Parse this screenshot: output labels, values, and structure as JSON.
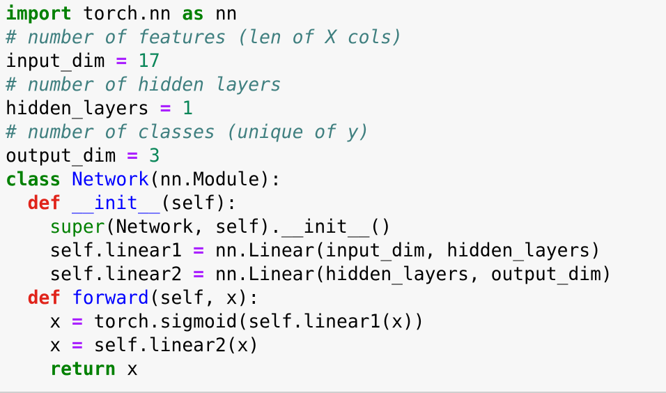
{
  "colors": {
    "background": "#f7f7f7",
    "keyword": "#008000",
    "def_keyword": "#e0241b",
    "comment": "#3f7f7f",
    "number": "#098658",
    "operator": "#aa22ff",
    "function_name": "#0000ff",
    "text": "#000000"
  },
  "lines": [
    [
      {
        "t": "import",
        "c": "kw"
      },
      {
        "t": " torch.nn ",
        "c": ""
      },
      {
        "t": "as",
        "c": "kw"
      },
      {
        "t": " nn",
        "c": ""
      }
    ],
    [
      {
        "t": "# number of features (len of X cols)",
        "c": "cm"
      }
    ],
    [
      {
        "t": "input_dim ",
        "c": ""
      },
      {
        "t": "=",
        "c": "op"
      },
      {
        "t": " ",
        "c": ""
      },
      {
        "t": "17",
        "c": "num"
      }
    ],
    [
      {
        "t": "# number of hidden layers",
        "c": "cm"
      }
    ],
    [
      {
        "t": "hidden_layers ",
        "c": ""
      },
      {
        "t": "=",
        "c": "op"
      },
      {
        "t": " ",
        "c": ""
      },
      {
        "t": "1",
        "c": "num"
      }
    ],
    [
      {
        "t": "# number of classes (unique of y)",
        "c": "cm"
      }
    ],
    [
      {
        "t": "output_dim ",
        "c": ""
      },
      {
        "t": "=",
        "c": "op"
      },
      {
        "t": " ",
        "c": ""
      },
      {
        "t": "3",
        "c": "num"
      }
    ],
    [
      {
        "t": "class",
        "c": "kw"
      },
      {
        "t": " ",
        "c": ""
      },
      {
        "t": "Network",
        "c": "fn"
      },
      {
        "t": "(nn.Module):",
        "c": ""
      }
    ],
    [
      {
        "t": "  ",
        "c": ""
      },
      {
        "t": "def",
        "c": "kwr"
      },
      {
        "t": " ",
        "c": ""
      },
      {
        "t": "__init__",
        "c": "fn"
      },
      {
        "t": "(self):",
        "c": ""
      }
    ],
    [
      {
        "t": "    ",
        "c": ""
      },
      {
        "t": "super",
        "c": "bi"
      },
      {
        "t": "(Network, self).__init__()",
        "c": ""
      }
    ],
    [
      {
        "t": "    self.linear1 ",
        "c": ""
      },
      {
        "t": "=",
        "c": "op"
      },
      {
        "t": " nn.Linear(input_dim, hidden_layers)",
        "c": ""
      }
    ],
    [
      {
        "t": "    self.linear2 ",
        "c": ""
      },
      {
        "t": "=",
        "c": "op"
      },
      {
        "t": " nn.Linear(hidden_layers, output_dim)",
        "c": ""
      }
    ],
    [
      {
        "t": "  ",
        "c": ""
      },
      {
        "t": "def",
        "c": "kwr"
      },
      {
        "t": " ",
        "c": ""
      },
      {
        "t": "forward",
        "c": "fn"
      },
      {
        "t": "(self, x):",
        "c": ""
      }
    ],
    [
      {
        "t": "    x ",
        "c": ""
      },
      {
        "t": "=",
        "c": "op"
      },
      {
        "t": " torch.sigmoid(self.linear1(x))",
        "c": ""
      }
    ],
    [
      {
        "t": "    x ",
        "c": ""
      },
      {
        "t": "=",
        "c": "op"
      },
      {
        "t": " self.linear2(x)",
        "c": ""
      }
    ],
    [
      {
        "t": "    ",
        "c": ""
      },
      {
        "t": "return",
        "c": "kw"
      },
      {
        "t": " x",
        "c": ""
      }
    ]
  ]
}
